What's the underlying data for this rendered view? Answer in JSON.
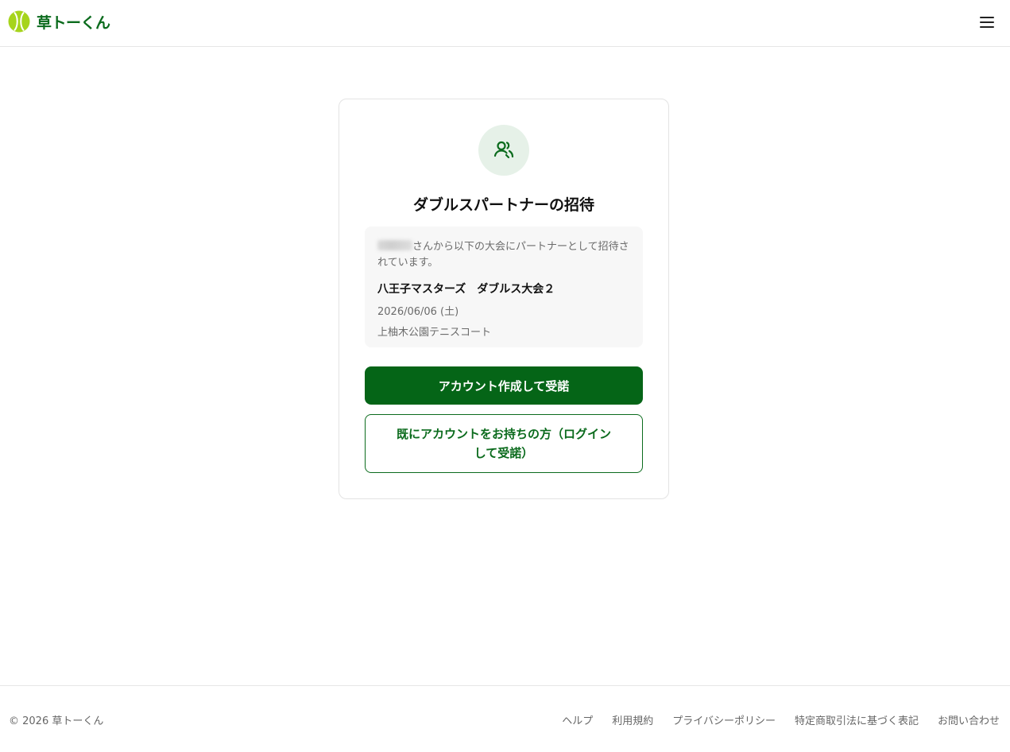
{
  "header": {
    "brand_name": "草トーくん",
    "logo_icon": "tennis-ball-icon",
    "menu_icon": "hamburger-menu-icon"
  },
  "card": {
    "icon": "users-icon",
    "title": "ダブルスパートナーの招待",
    "invite": {
      "inviter_name_hidden": true,
      "message": "さんから以下の大会にパートナーとして招待されています。"
    },
    "event": {
      "name": "八王子マスターズ　ダブルス大会２",
      "date": "2026/06/06 (土)",
      "venue": "上柚木公園テニスコート"
    },
    "primary_button": "アカウント作成して受諾",
    "secondary_button": "既にアカウントをお持ちの方（ログインして受諾）"
  },
  "footer": {
    "copyright": "© 2026 草トーくん",
    "links": [
      "ヘルプ",
      "利用規約",
      "プライバシーポリシー",
      "特定商取引法に基づく表記",
      "お問い合わせ"
    ]
  },
  "colors": {
    "brand_green": "#056517",
    "icon_bg": "#e6f1e8",
    "ball_yellow": "#a6d41c"
  }
}
